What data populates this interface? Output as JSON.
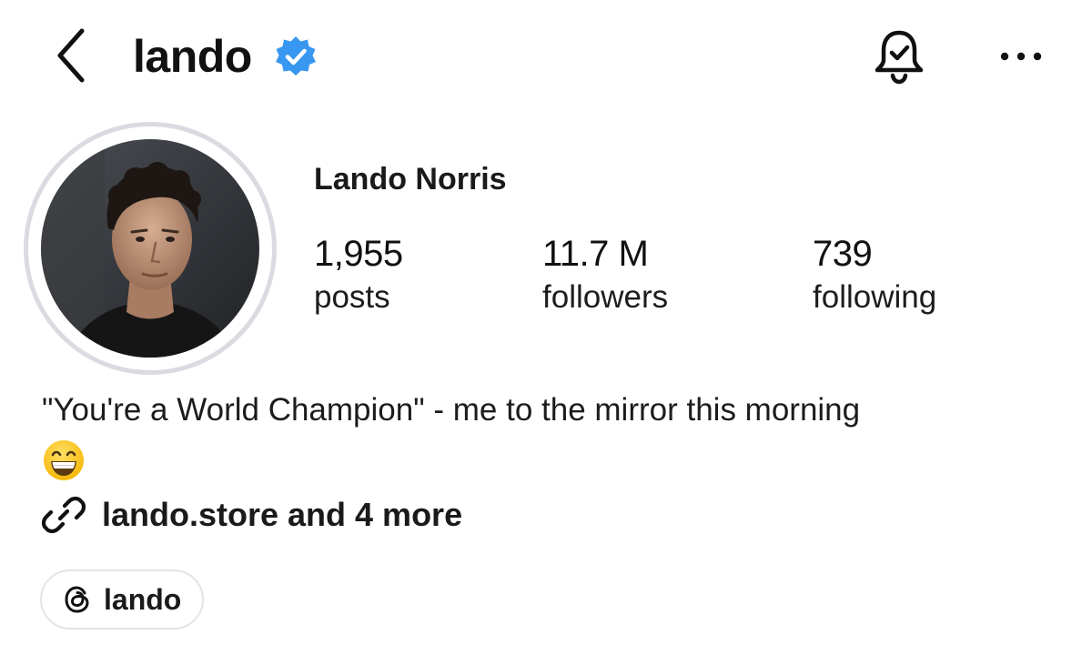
{
  "header": {
    "username": "lando",
    "verified": true,
    "icons": {
      "back": "chevron-left-icon",
      "verified": "verified-badge-icon",
      "notifications": "bell-check-icon",
      "more": "more-horizontal-icon"
    }
  },
  "profile": {
    "display_name": "Lando Norris",
    "avatar": "profile-photo",
    "stats": {
      "posts": {
        "value": "1,955",
        "label": "posts"
      },
      "followers": {
        "value": "11.7 M",
        "label": "followers"
      },
      "following": {
        "value": "739",
        "label": "following"
      }
    },
    "bio": "\"You're a World Champion\" - me to the mirror this morning",
    "bio_emoji": "grinning-face-emoji",
    "links": {
      "icon": "link-icon",
      "text": "lando.store and 4 more"
    },
    "threads": {
      "icon": "threads-icon",
      "label": "lando"
    }
  },
  "colors": {
    "verified_blue": "#3897f0",
    "avatar_ring": "#d9dbe0",
    "text": "#111111",
    "pill_border": "#e4e4e7"
  }
}
